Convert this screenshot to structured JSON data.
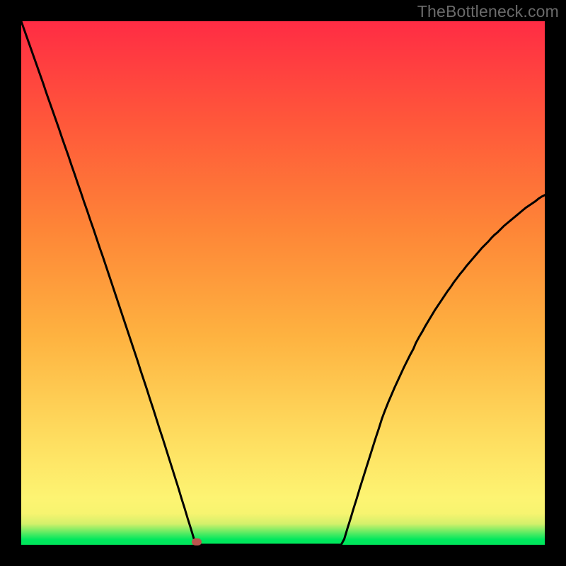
{
  "watermark": "TheBottleneck.com",
  "chart_data": {
    "type": "line",
    "title": "",
    "xlabel": "",
    "ylabel": "",
    "xlim": [
      0,
      1
    ],
    "ylim": [
      0,
      1
    ],
    "grid": false,
    "x": [
      0.0,
      0.006,
      0.012,
      0.018,
      0.024,
      0.03,
      0.036,
      0.042,
      0.048,
      0.054,
      0.06,
      0.066,
      0.072,
      0.078,
      0.084,
      0.09,
      0.096,
      0.102,
      0.108,
      0.114,
      0.12,
      0.126,
      0.132,
      0.138,
      0.144,
      0.15,
      0.156,
      0.162,
      0.168,
      0.174,
      0.18,
      0.186,
      0.192,
      0.198,
      0.204,
      0.21,
      0.216,
      0.222,
      0.228,
      0.234,
      0.24,
      0.246,
      0.252,
      0.258,
      0.264,
      0.27,
      0.276,
      0.282,
      0.288,
      0.294,
      0.3,
      0.306,
      0.312,
      0.318,
      0.324,
      0.33,
      0.335,
      0.341,
      0.605,
      0.611,
      0.617,
      0.623,
      0.629,
      0.635,
      0.641,
      0.647,
      0.653,
      0.659,
      0.665,
      0.671,
      0.677,
      0.683,
      0.689,
      0.695,
      0.701,
      0.707,
      0.713,
      0.719,
      0.725,
      0.731,
      0.737,
      0.743,
      0.749,
      0.754,
      0.76,
      0.766,
      0.772,
      0.778,
      0.784,
      0.79,
      0.796,
      0.802,
      0.808,
      0.814,
      0.82,
      0.826,
      0.832,
      0.838,
      0.844,
      0.85,
      0.856,
      0.862,
      0.868,
      0.874,
      0.88,
      0.886,
      0.892,
      0.898,
      0.904,
      0.91,
      0.916,
      0.922,
      0.928,
      0.934,
      0.94,
      0.946,
      0.952,
      0.958,
      0.964,
      0.97,
      0.976,
      0.982,
      0.988,
      0.994,
      1.0
    ],
    "values": [
      1.0,
      0.983,
      0.966,
      0.949,
      0.932,
      0.915,
      0.898,
      0.881,
      0.863,
      0.846,
      0.829,
      0.812,
      0.795,
      0.777,
      0.76,
      0.743,
      0.725,
      0.708,
      0.69,
      0.673,
      0.655,
      0.638,
      0.62,
      0.603,
      0.585,
      0.567,
      0.55,
      0.532,
      0.514,
      0.496,
      0.478,
      0.46,
      0.442,
      0.424,
      0.406,
      0.388,
      0.37,
      0.352,
      0.333,
      0.315,
      0.297,
      0.278,
      0.26,
      0.241,
      0.222,
      0.204,
      0.185,
      0.166,
      0.147,
      0.128,
      0.109,
      0.089,
      0.07,
      0.05,
      0.031,
      0.011,
      0.0,
      0.0,
      0.0,
      0.0,
      0.011,
      0.031,
      0.05,
      0.07,
      0.089,
      0.109,
      0.128,
      0.147,
      0.166,
      0.185,
      0.204,
      0.222,
      0.241,
      0.257,
      0.272,
      0.286,
      0.3,
      0.313,
      0.326,
      0.339,
      0.351,
      0.363,
      0.374,
      0.386,
      0.397,
      0.407,
      0.418,
      0.428,
      0.438,
      0.448,
      0.457,
      0.466,
      0.475,
      0.484,
      0.492,
      0.501,
      0.509,
      0.517,
      0.524,
      0.532,
      0.539,
      0.546,
      0.553,
      0.56,
      0.567,
      0.573,
      0.579,
      0.586,
      0.592,
      0.597,
      0.603,
      0.609,
      0.614,
      0.619,
      0.624,
      0.629,
      0.634,
      0.639,
      0.644,
      0.648,
      0.652,
      0.656,
      0.661,
      0.665,
      0.668
    ],
    "marker": {
      "x_fraction": 0.335,
      "y_fraction": 0.006
    },
    "background_gradient": {
      "stops": [
        {
          "y_fraction": 0.0,
          "color": "#00e55b"
        },
        {
          "y_fraction": 0.01,
          "color": "#00e85d"
        },
        {
          "y_fraction": 0.025,
          "color": "#6aec64"
        },
        {
          "y_fraction": 0.04,
          "color": "#d4f06b"
        },
        {
          "y_fraction": 0.06,
          "color": "#f7f470"
        },
        {
          "y_fraction": 0.09,
          "color": "#fdf472"
        },
        {
          "y_fraction": 0.2,
          "color": "#fede60"
        },
        {
          "y_fraction": 0.4,
          "color": "#feb240"
        },
        {
          "y_fraction": 0.6,
          "color": "#fe8637"
        },
        {
          "y_fraction": 0.8,
          "color": "#ff593a"
        },
        {
          "y_fraction": 1.0,
          "color": "#ff2c44"
        }
      ]
    }
  }
}
